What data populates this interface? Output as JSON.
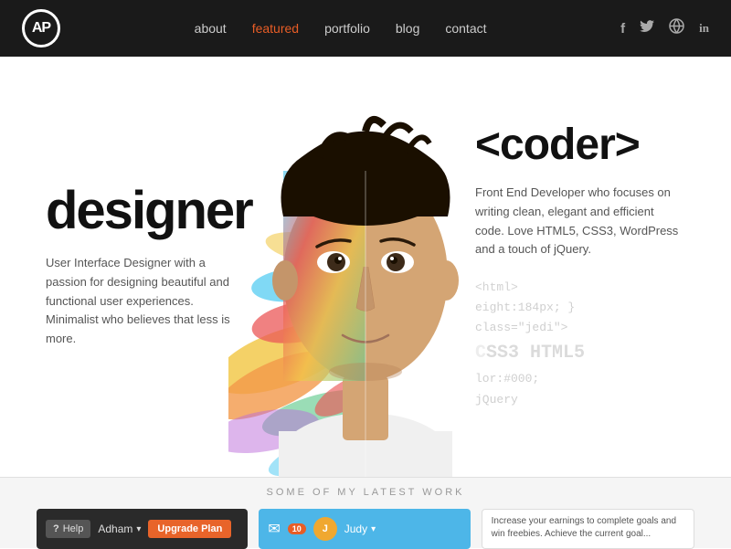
{
  "header": {
    "logo_text": "AP",
    "nav": {
      "items": [
        {
          "label": "about",
          "active": false
        },
        {
          "label": "featured",
          "active": true
        },
        {
          "label": "portfolio",
          "active": false
        },
        {
          "label": "blog",
          "active": false
        },
        {
          "label": "contact",
          "active": false
        }
      ]
    },
    "social": [
      {
        "name": "facebook",
        "symbol": "f"
      },
      {
        "name": "twitter",
        "symbol": "🐦"
      },
      {
        "name": "dribbble",
        "symbol": "⊕"
      },
      {
        "name": "linkedin",
        "symbol": "in"
      }
    ]
  },
  "hero": {
    "left_heading": "designer",
    "left_description": "User Interface Designer with a passion for designing beautiful and functional user experiences. Minimalist who believes that less is more.",
    "right_heading": "<coder>",
    "right_description": "Front End Developer who focuses on writing clean, elegant and efficient code. Love HTML5, CSS3, WordPress and a touch of jQuery.",
    "code_lines": [
      "<html>",
      "eight:184px; }",
      "class=\"jedi\">",
      "SS3 HTML5",
      "lor:#000;",
      "jQuery"
    ]
  },
  "bottom_section": {
    "label": "SOME OF MY LATEST WORK",
    "cards": [
      {
        "type": "dark",
        "help": "Help",
        "user": "Adham",
        "upgrade": "Upgrade Plan"
      },
      {
        "type": "blue",
        "badge": "10",
        "user": "Judy"
      },
      {
        "type": "light",
        "text": "Increase your earnings to complete goals and win freebies. Achieve the current goal..."
      }
    ]
  },
  "colors": {
    "header_bg": "#1a1a1a",
    "accent": "#e85d26",
    "blue": "#4db6e8"
  }
}
